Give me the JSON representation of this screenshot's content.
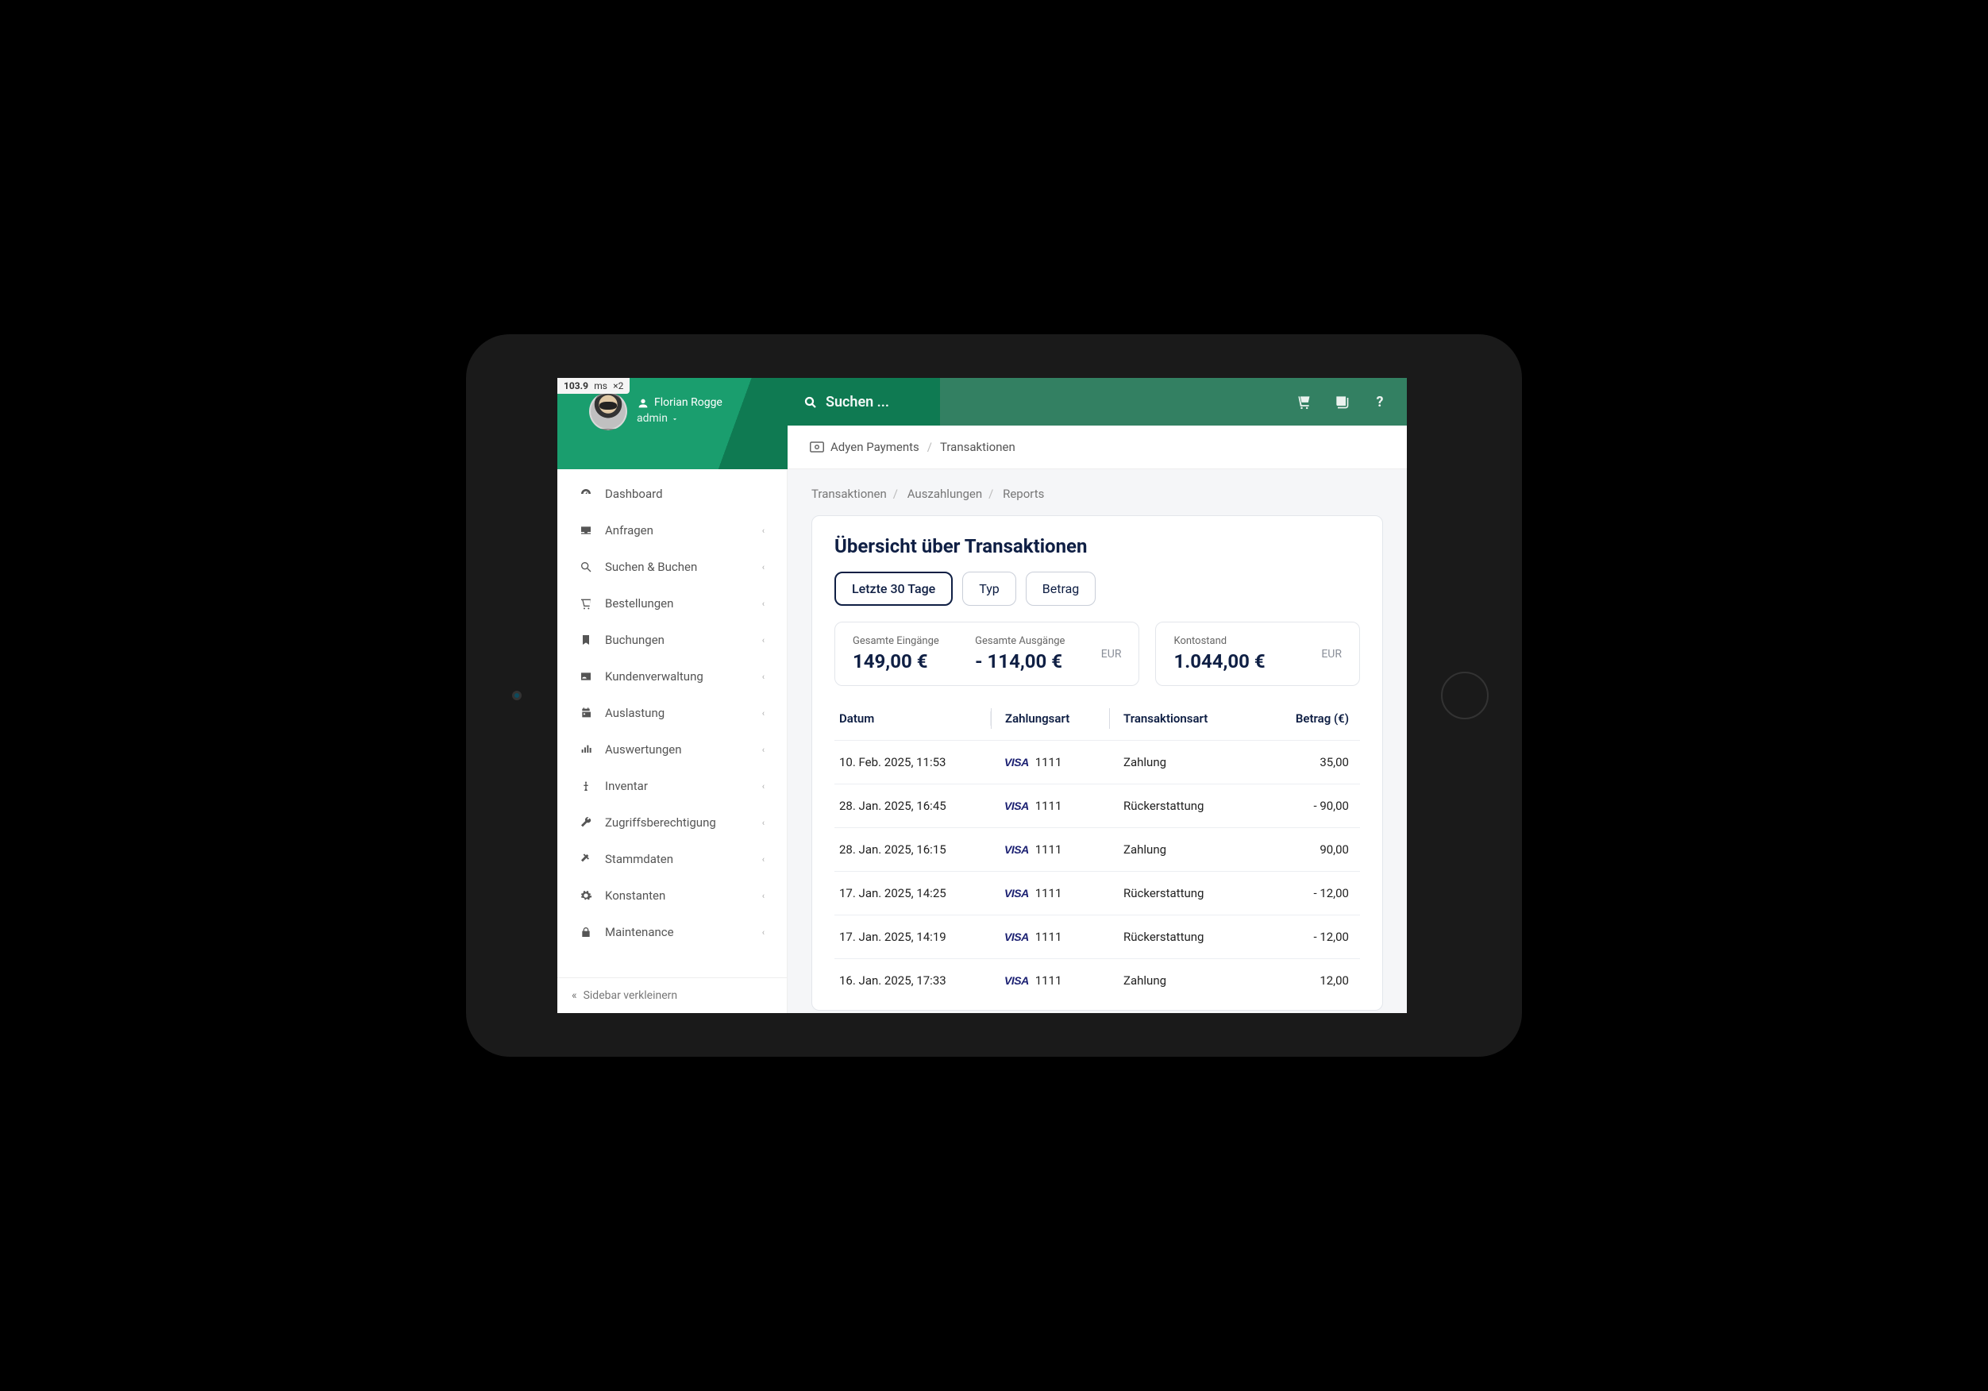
{
  "perf": {
    "ms": "103.9",
    "unit": "ms",
    "mult": "×2"
  },
  "user": {
    "name": "Florian Rogge",
    "role": "admin"
  },
  "search": {
    "placeholder": "Suchen ..."
  },
  "breadcrumb": {
    "section": "Adyen Payments",
    "page": "Transaktionen"
  },
  "sidebar": {
    "items": [
      {
        "icon": "dashboard",
        "label": "Dashboard",
        "expandable": false
      },
      {
        "icon": "inbox",
        "label": "Anfragen",
        "expandable": true
      },
      {
        "icon": "search",
        "label": "Suchen & Buchen",
        "expandable": true
      },
      {
        "icon": "cart",
        "label": "Bestellungen",
        "expandable": true
      },
      {
        "icon": "bookmark",
        "label": "Buchungen",
        "expandable": true
      },
      {
        "icon": "idcard",
        "label": "Kundenverwaltung",
        "expandable": true
      },
      {
        "icon": "calendar",
        "label": "Auslastung",
        "expandable": true
      },
      {
        "icon": "bars",
        "label": "Auswertungen",
        "expandable": true
      },
      {
        "icon": "person",
        "label": "Inventar",
        "expandable": true
      },
      {
        "icon": "wrench",
        "label": "Zugriffsberechtigung",
        "expandable": true
      },
      {
        "icon": "tool",
        "label": "Stammdaten",
        "expandable": true
      },
      {
        "icon": "gear",
        "label": "Konstanten",
        "expandable": true
      },
      {
        "icon": "lock",
        "label": "Maintenance",
        "expandable": true
      }
    ],
    "collapse": "Sidebar verkleinern"
  },
  "subcrumbs": {
    "a": "Transaktionen",
    "b": "Auszahlungen",
    "c": "Reports"
  },
  "overview": {
    "title": "Übersicht über Transaktionen",
    "filters": {
      "range": "Letzte 30 Tage",
      "type": "Typ",
      "amount": "Betrag"
    },
    "summary": {
      "in_label": "Gesamte Eingänge",
      "in_value": "149,00 €",
      "out_label": "Gesamte Ausgänge",
      "out_value": "- 114,00 €",
      "balance_label": "Kontostand",
      "balance_value": "1.044,00 €",
      "currency": "EUR"
    },
    "columns": {
      "date": "Datum",
      "method": "Zahlungsart",
      "type": "Transaktionsart",
      "amount": "Betrag (€)"
    },
    "rows": [
      {
        "date": "10. Feb. 2025, 11:53",
        "brand": "VISA",
        "last4": "1111",
        "type": "Zahlung",
        "amount": "35,00"
      },
      {
        "date": "28. Jan. 2025, 16:45",
        "brand": "VISA",
        "last4": "1111",
        "type": "Rückerstattung",
        "amount": "- 90,00"
      },
      {
        "date": "28. Jan. 2025, 16:15",
        "brand": "VISA",
        "last4": "1111",
        "type": "Zahlung",
        "amount": "90,00"
      },
      {
        "date": "17. Jan. 2025, 14:25",
        "brand": "VISA",
        "last4": "1111",
        "type": "Rückerstattung",
        "amount": "- 12,00"
      },
      {
        "date": "17. Jan. 2025, 14:19",
        "brand": "VISA",
        "last4": "1111",
        "type": "Rückerstattung",
        "amount": "- 12,00"
      },
      {
        "date": "16. Jan. 2025, 17:33",
        "brand": "VISA",
        "last4": "1111",
        "type": "Zahlung",
        "amount": "12,00"
      }
    ]
  }
}
